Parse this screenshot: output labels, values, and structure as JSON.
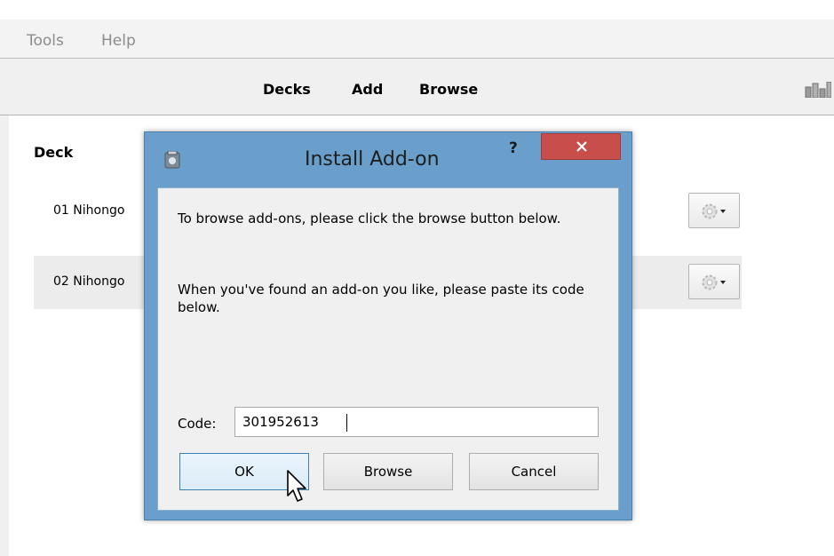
{
  "menu": {
    "items": [
      "Tools",
      "Help"
    ]
  },
  "toolbar": {
    "decks": "Decks",
    "add": "Add",
    "browse": "Browse",
    "stats_icon": "stats-icon"
  },
  "deck_list": {
    "header": "Deck",
    "rows": [
      {
        "name": "01 Nihongo",
        "gear_icon": "gear-icon"
      },
      {
        "name": "02 Nihongo",
        "gear_icon": "gear-icon"
      }
    ]
  },
  "dialog": {
    "title": "Install Add-on",
    "help": "?",
    "line1": "To browse add-ons, please click the browse button below.",
    "line2": "When you've found an add-on you like, please paste its code below.",
    "code_label": "Code:",
    "code_value": "301952613",
    "ok_label": "OK",
    "browse_label": "Browse",
    "cancel_label": "Cancel"
  },
  "colors": {
    "dialog_frame": "#6a9fcc",
    "close_button": "#c84e4c",
    "default_button_border": "#3c7fb1"
  }
}
